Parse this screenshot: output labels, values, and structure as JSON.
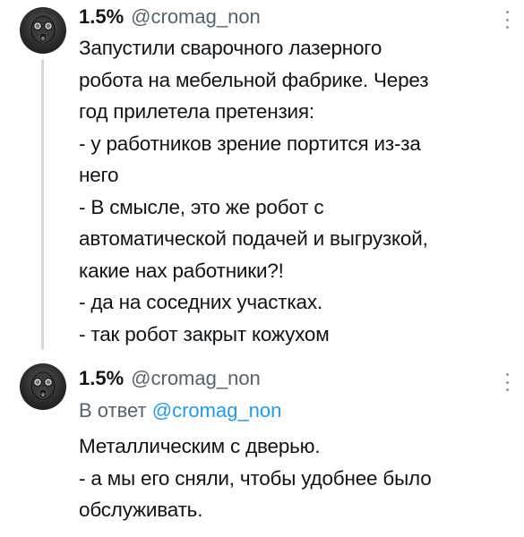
{
  "tweets": [
    {
      "display_name": "1.5%",
      "handle": "@cromag_non",
      "avatar_icon": "gas-mask-avatar-icon",
      "more_icon": "more-dots-icon",
      "lines": [
        "Запустили сварочного лазерного",
        "робота на мебельной фабрике.  Через",
        "год прилетела претензия:",
        "- у работников зрение портится из-за",
        "него",
        "- В смысле, это же робот с",
        "автоматической подачей и выгрузкой,",
        "какие нах работники?!",
        "- да на соседних участках.",
        "- так робот закрыт кожухом"
      ]
    },
    {
      "display_name": "1.5%",
      "handle": "@cromag_non",
      "avatar_icon": "gas-mask-avatar-icon",
      "more_icon": "more-dots-icon",
      "reply_prefix": "В ответ",
      "reply_handle": "@cromag_non",
      "lines": [
        "Металлическим с дверью.",
        "- а мы его сняли, чтобы удобнее было",
        "обслуживать."
      ]
    }
  ],
  "colors": {
    "text": "#0f1419",
    "secondary": "#536471",
    "link": "#1d9bf0",
    "thread_line": "#cfd9de"
  }
}
